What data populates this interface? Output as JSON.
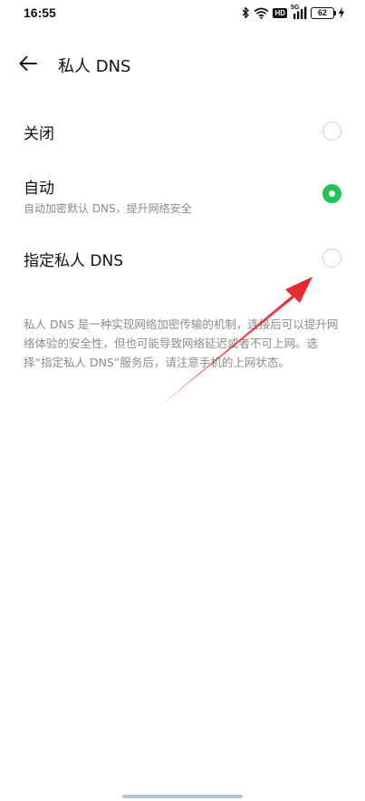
{
  "status_bar": {
    "time": "16:55",
    "network_badge": "HD",
    "network_type": "5G",
    "battery_level": "62"
  },
  "header": {
    "back_icon": "arrow-left-icon",
    "title": "私人 DNS"
  },
  "options": [
    {
      "label": "关闭",
      "sublabel": "",
      "selected": false
    },
    {
      "label": "自动",
      "sublabel": "自动加密默认 DNS，提升网络安全",
      "selected": true
    },
    {
      "label": "指定私人 DNS",
      "sublabel": "",
      "selected": false
    }
  ],
  "note": "私人 DNS 是一种实现网络加密传输的机制，连接后可以提升网络体验的安全性，但也可能导致网络延迟或者不可上网。选择“指定私人 DNS”服务后，请注意手机的上网状态。",
  "colors": {
    "accent": "#1fc35a",
    "annotation_arrow": "#e8202a"
  }
}
